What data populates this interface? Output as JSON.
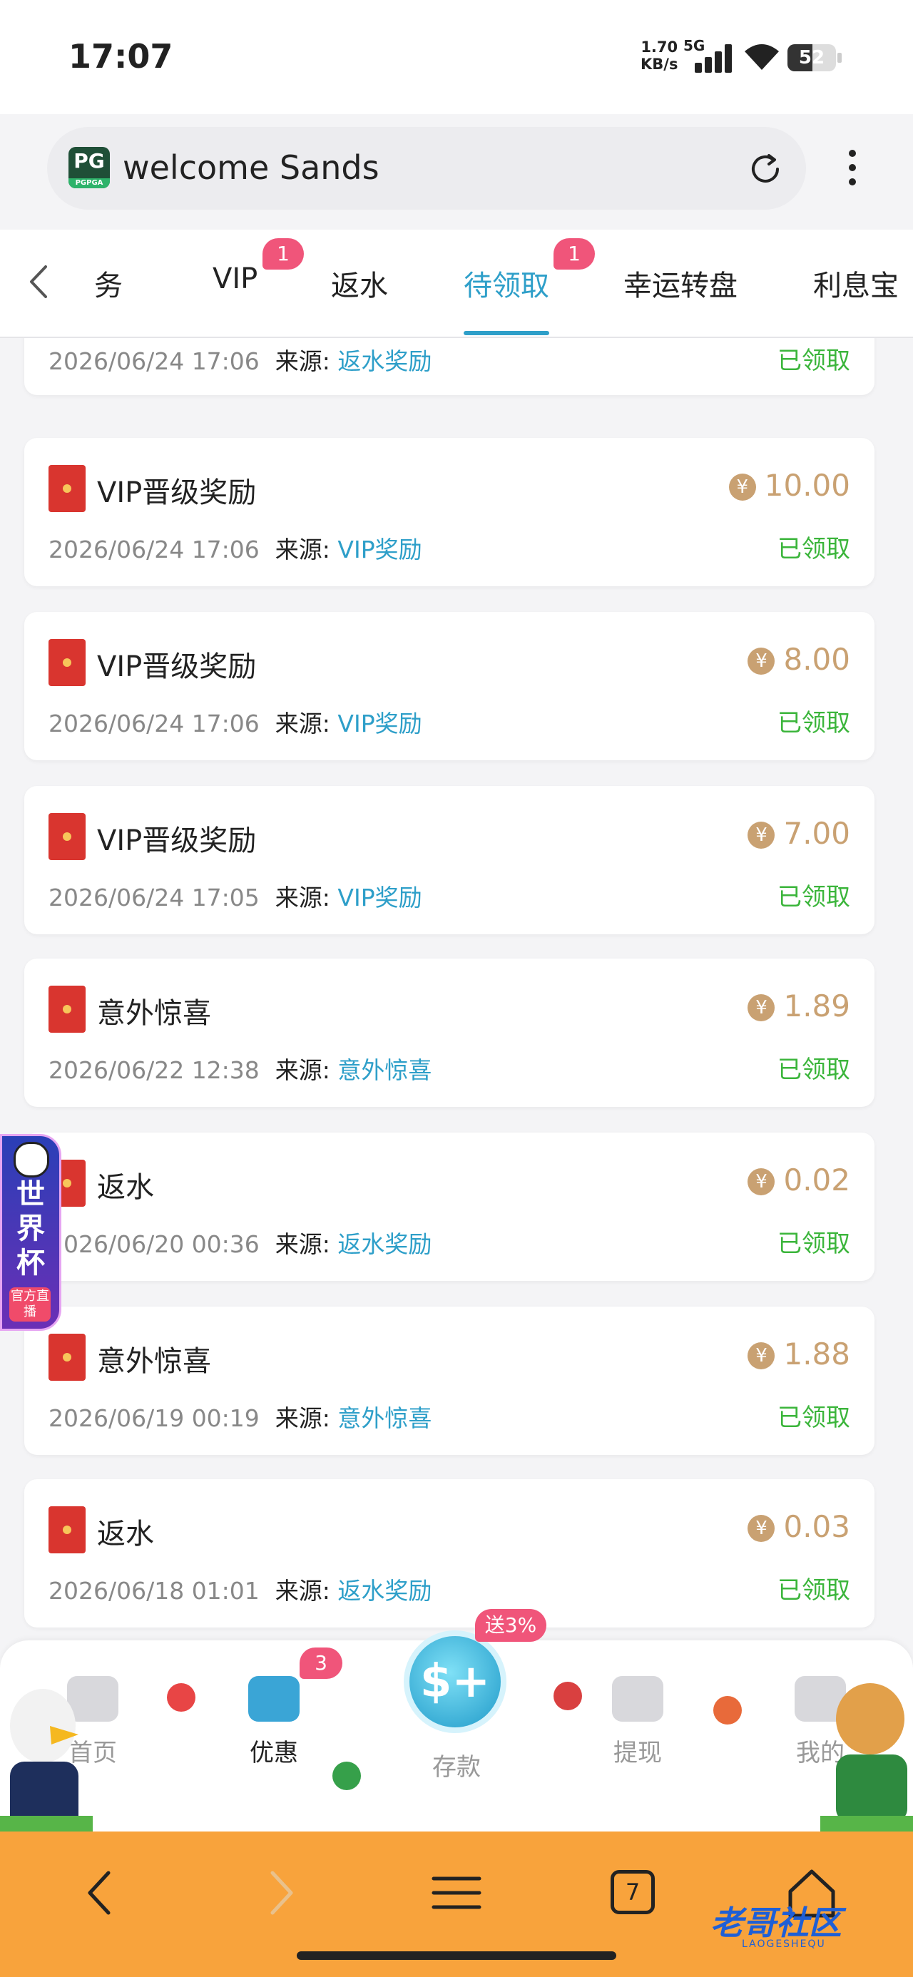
{
  "status_bar": {
    "time": "17:07",
    "net_speed_value": "1.70",
    "net_speed_unit": "KB/s",
    "network": "5G",
    "battery": "52",
    "battery_level": 0.52
  },
  "address_bar": {
    "site_logo": "PG",
    "site_logo_sub": "PGPGA",
    "url_text": "welcome Sands"
  },
  "tabs": {
    "items": [
      {
        "label": "任务"
      },
      {
        "label": "VIP",
        "badge": "1"
      },
      {
        "label": "返水"
      },
      {
        "label": "待领取",
        "badge": "1",
        "active": true
      },
      {
        "label": "幸运转盘"
      },
      {
        "label": "利息宝"
      }
    ]
  },
  "records": [
    {
      "date": "2026/06/24 17:06",
      "source_label": "来源:",
      "source": "返水奖励",
      "status": "已领取"
    },
    {
      "title": "VIP晋级奖励",
      "amount": "10.00",
      "date": "2026/06/24 17:06",
      "source_label": "来源:",
      "source": "VIP奖励",
      "status": "已领取"
    },
    {
      "title": "VIP晋级奖励",
      "amount": "8.00",
      "date": "2026/06/24 17:06",
      "source_label": "来源:",
      "source": "VIP奖励",
      "status": "已领取"
    },
    {
      "title": "VIP晋级奖励",
      "amount": "7.00",
      "date": "2026/06/24 17:05",
      "source_label": "来源:",
      "source": "VIP奖励",
      "status": "已领取"
    },
    {
      "title": "意外惊喜",
      "amount": "1.89",
      "date": "2026/06/22 12:38",
      "source_label": "来源:",
      "source": "意外惊喜",
      "status": "已领取"
    },
    {
      "title": "返水",
      "amount": "0.02",
      "date": "2026/06/20 00:36",
      "source_label": "来源:",
      "source": "返水奖励",
      "status": "已领取"
    },
    {
      "title": "意外惊喜",
      "amount": "1.88",
      "date": "2026/06/19 00:19",
      "source_label": "来源:",
      "source": "意外惊喜",
      "status": "已领取"
    },
    {
      "title": "返水",
      "amount": "0.03",
      "date": "2026/06/18 01:01",
      "source_label": "来源:",
      "source": "返水奖励",
      "status": "已领取"
    }
  ],
  "currency_symbol": "¥",
  "float_banner": {
    "title": "世界杯",
    "sub": "官方直播"
  },
  "app_nav": {
    "items": [
      {
        "label": "首页"
      },
      {
        "label": "优惠",
        "badge": "3",
        "active": true
      },
      {
        "label": "存款"
      },
      {
        "label": "提现"
      },
      {
        "label": "我的"
      }
    ],
    "deposit_icon": "$+",
    "promo_tag": "送3%"
  },
  "browser_bar": {
    "tab_count": "7"
  },
  "watermark": {
    "text": "老哥社区",
    "sub": "LAOGESHEQU"
  },
  "colors": {
    "accent": "#2e9fc9",
    "amount": "#c9a172",
    "claimed": "#3bb53b",
    "badge": "#f0557a",
    "browser_bar": "#f8a33c"
  }
}
